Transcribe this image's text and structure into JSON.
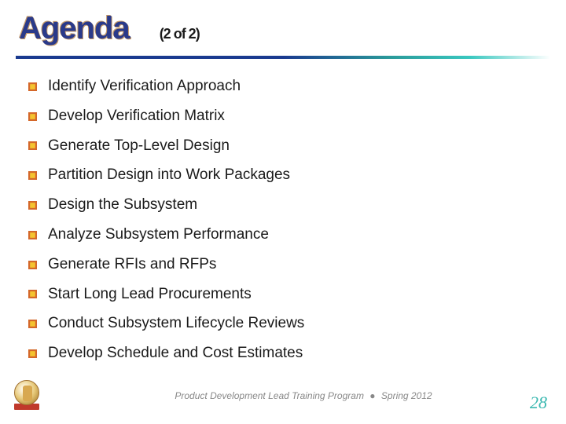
{
  "header": {
    "title": "Agenda",
    "page_indicator": "(2 of 2)"
  },
  "bullets": [
    "Identify Verification Approach",
    "Develop Verification Matrix",
    "Generate Top-Level Design",
    "Partition Design into Work Packages",
    "Design the Subsystem",
    "Analyze Subsystem Performance",
    "Generate RFIs and RFPs",
    "Start Long Lead Procurements",
    "Conduct Subsystem Lifecycle Reviews",
    "Develop Schedule and Cost Estimates"
  ],
  "footer": {
    "program": "Product Development Lead Training Program",
    "separator": "●",
    "term": "Spring 2012",
    "page_number": "28"
  }
}
